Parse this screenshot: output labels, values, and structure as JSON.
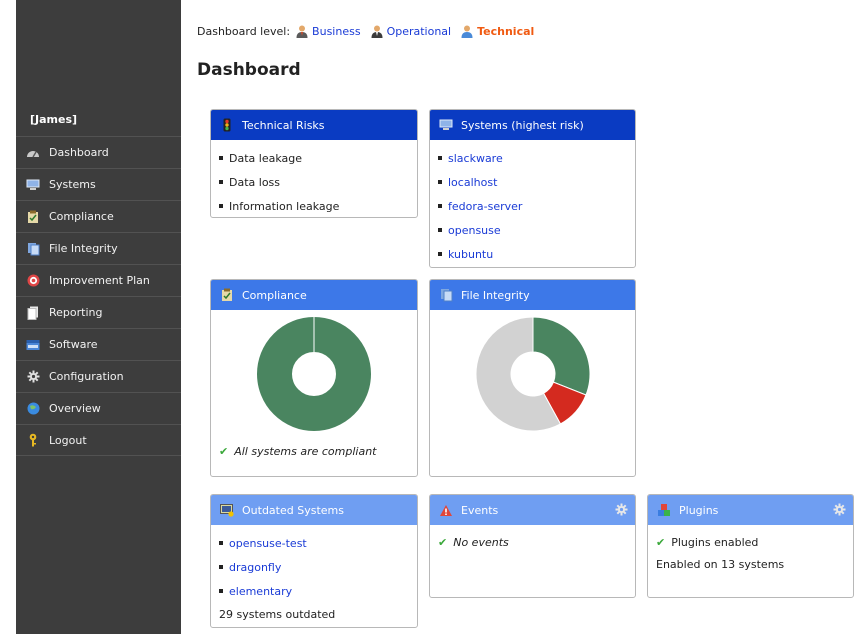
{
  "sidebar": {
    "user": "[James]",
    "items": [
      {
        "label": "Dashboard",
        "icon": "dashboard-icon"
      },
      {
        "label": "Systems",
        "icon": "systems-icon"
      },
      {
        "label": "Compliance",
        "icon": "compliance-icon"
      },
      {
        "label": "File Integrity",
        "icon": "file-integrity-icon"
      },
      {
        "label": "Improvement Plan",
        "icon": "target-icon"
      },
      {
        "label": "Reporting",
        "icon": "reporting-icon"
      },
      {
        "label": "Software",
        "icon": "software-icon"
      },
      {
        "label": "Configuration",
        "icon": "gear-icon"
      },
      {
        "label": "Overview",
        "icon": "globe-icon"
      },
      {
        "label": "Logout",
        "icon": "key-icon"
      }
    ]
  },
  "header": {
    "level_label": "Dashboard level:",
    "levels": [
      "Business",
      "Operational",
      "Technical"
    ],
    "active_level": "Technical",
    "title": "Dashboard"
  },
  "panels": {
    "technical_risks": {
      "title": "Technical Risks",
      "items": [
        "Data leakage",
        "Data loss",
        "Information leakage"
      ]
    },
    "systems": {
      "title": "Systems (highest risk)",
      "items": [
        "slackware",
        "localhost",
        "fedora-server",
        "opensuse",
        "kubuntu"
      ]
    },
    "compliance": {
      "title": "Compliance",
      "status": "All systems are compliant"
    },
    "file_integrity": {
      "title": "File Integrity"
    },
    "outdated": {
      "title": "Outdated Systems",
      "items": [
        "opensuse-test",
        "dragonfly",
        "elementary"
      ],
      "summary": "29 systems outdated"
    },
    "events": {
      "title": "Events",
      "status": "No events"
    },
    "plugins": {
      "title": "Plugins",
      "status": "Plugins enabled",
      "summary": "Enabled on 13 systems"
    }
  },
  "chart_data": [
    {
      "type": "pie",
      "name": "compliance",
      "slices": [
        {
          "label": "compliant",
          "value": 100,
          "color": "#4a8560"
        }
      ]
    },
    {
      "type": "pie",
      "name": "file_integrity",
      "slices": [
        {
          "label": "green",
          "value": 31,
          "color": "#4a8560"
        },
        {
          "label": "red",
          "value": 11,
          "color": "#d42a1f"
        },
        {
          "label": "grey",
          "value": 58,
          "color": "#d2d2d2"
        }
      ]
    }
  ]
}
